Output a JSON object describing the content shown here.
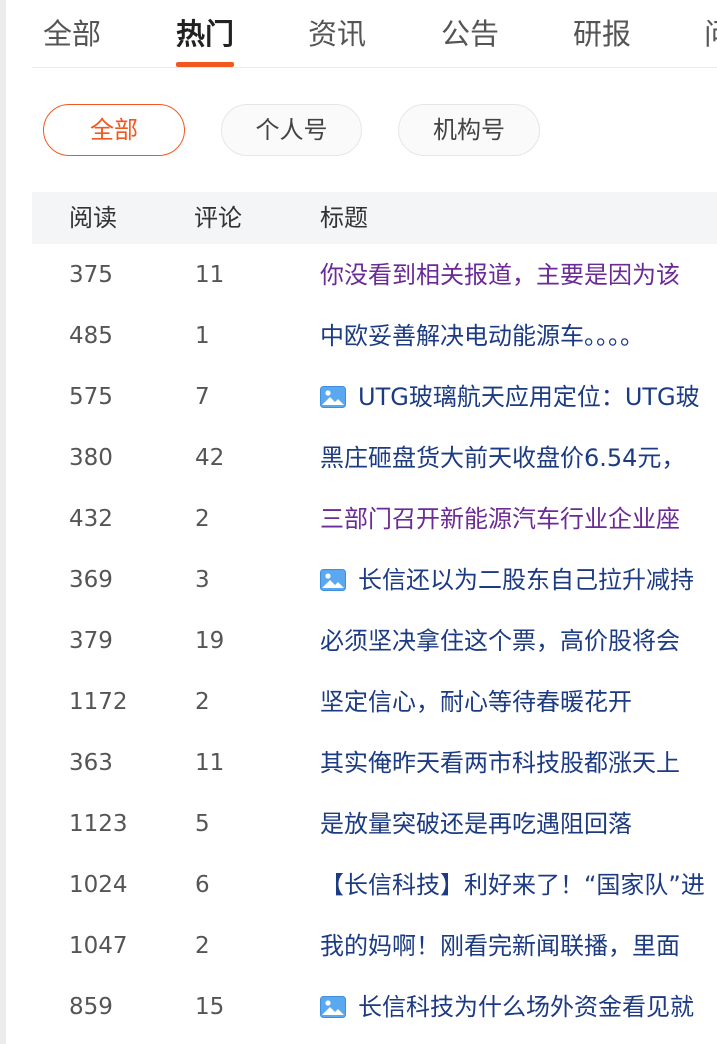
{
  "tabs": [
    {
      "label": "全部",
      "active": false
    },
    {
      "label": "热门",
      "active": true
    },
    {
      "label": "资讯",
      "active": false
    },
    {
      "label": "公告",
      "active": false
    },
    {
      "label": "研报",
      "active": false
    },
    {
      "label": "问",
      "active": false
    }
  ],
  "filters": [
    {
      "label": "全部",
      "active": true
    },
    {
      "label": "个人号",
      "active": false
    },
    {
      "label": "机构号",
      "active": false
    }
  ],
  "table": {
    "headers": {
      "reads": "阅读",
      "comments": "评论",
      "title": "标题"
    },
    "rows": [
      {
        "reads": "375",
        "comments": "11",
        "title": "你没看到相关报道，主要是因为该",
        "has_image": false,
        "visited": true
      },
      {
        "reads": "485",
        "comments": "1",
        "title": "中欧妥善解决电动能源车。。。。",
        "has_image": false,
        "visited": false
      },
      {
        "reads": "575",
        "comments": "7",
        "title": "UTG玻璃航天应用定位：UTG玻",
        "has_image": true,
        "visited": false
      },
      {
        "reads": "380",
        "comments": "42",
        "title": "黑庄砸盘货大前天收盘价6.54元，",
        "has_image": false,
        "visited": false
      },
      {
        "reads": "432",
        "comments": "2",
        "title": "三部门召开新能源汽车行业企业座",
        "has_image": false,
        "visited": true
      },
      {
        "reads": "369",
        "comments": "3",
        "title": "长信还以为二股东自己拉升减持",
        "has_image": true,
        "visited": false
      },
      {
        "reads": "379",
        "comments": "19",
        "title": "必须坚决拿住这个票，高价股将会",
        "has_image": false,
        "visited": false
      },
      {
        "reads": "1172",
        "comments": "2",
        "title": "坚定信心，耐心等待春暖花开",
        "has_image": false,
        "visited": false
      },
      {
        "reads": "363",
        "comments": "11",
        "title": "其实俺昨天看两市科技股都涨天上",
        "has_image": false,
        "visited": false
      },
      {
        "reads": "1123",
        "comments": "5",
        "title": "是放量突破还是再吃遇阻回落",
        "has_image": false,
        "visited": false
      },
      {
        "reads": "1024",
        "comments": "6",
        "title": "【长信科技】利好来了！“国家队”进",
        "has_image": false,
        "visited": false
      },
      {
        "reads": "1047",
        "comments": "2",
        "title": "我的妈啊！刚看完新闻联播，里面",
        "has_image": false,
        "visited": false
      },
      {
        "reads": "859",
        "comments": "15",
        "title": "长信科技为什么场外资金看见就",
        "has_image": true,
        "visited": false
      }
    ]
  },
  "colors": {
    "accent": "#f2581e",
    "link": "#1c3b82",
    "visited_link": "#6b2b96"
  },
  "icons": {
    "image_badge": "image-icon"
  }
}
